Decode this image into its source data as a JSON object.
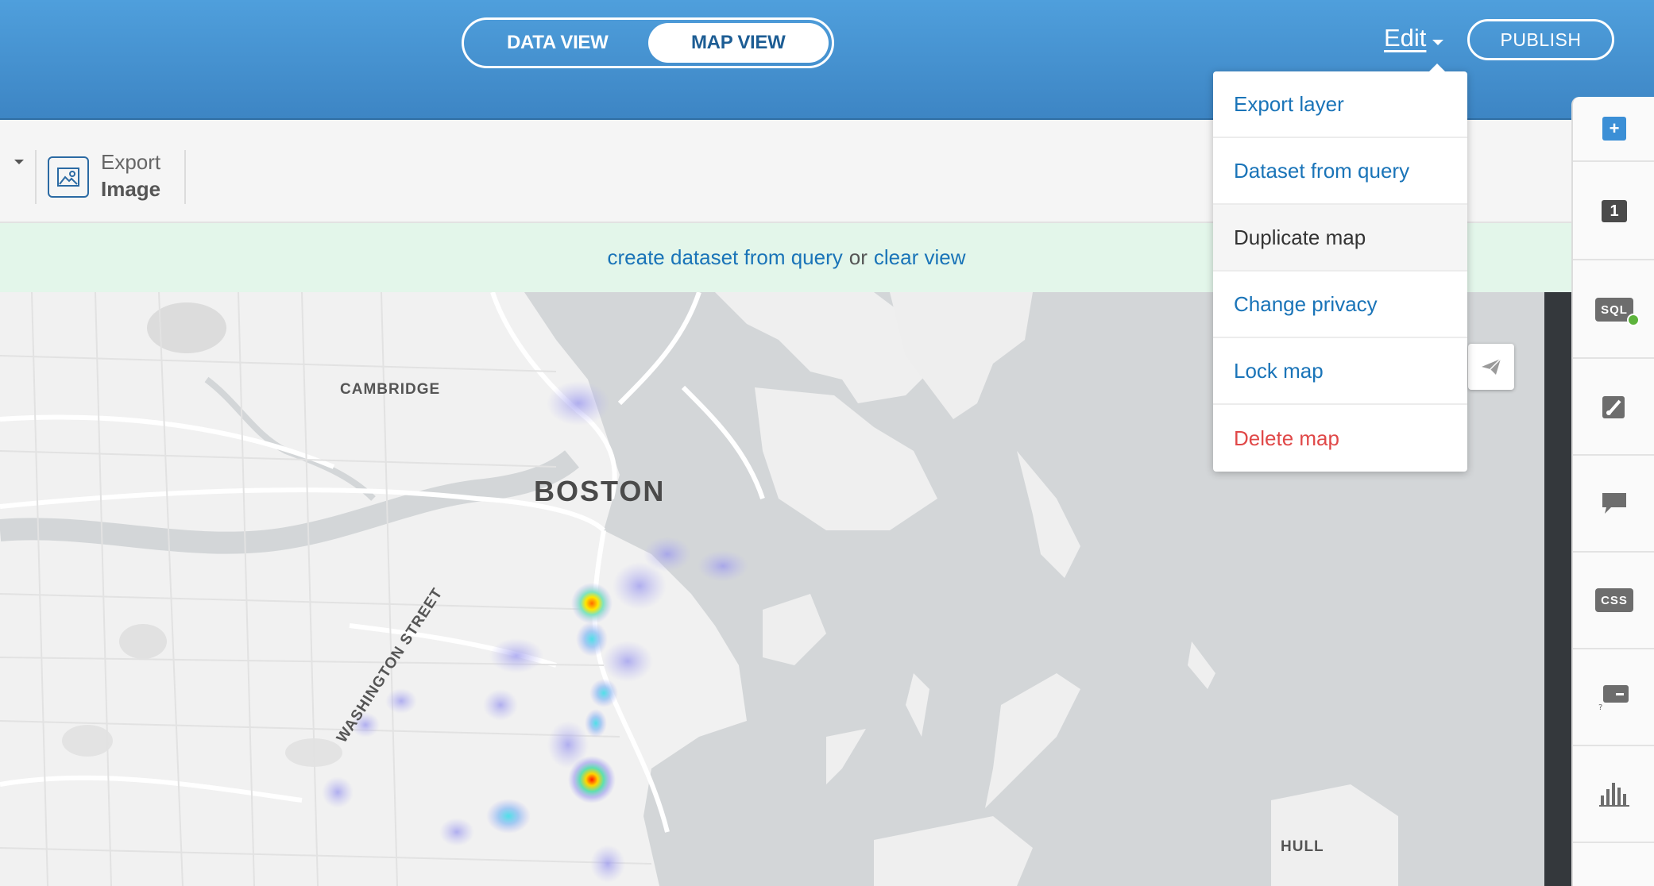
{
  "header": {
    "view_toggle": {
      "data_view": "DATA VIEW",
      "map_view": "MAP VIEW",
      "active": "map_view"
    },
    "edit_label": "Edit",
    "publish_label": "PUBLISH"
  },
  "toolbar": {
    "export_image": {
      "line1": "Export",
      "line2": "Image",
      "icon": "image-icon"
    }
  },
  "notice": {
    "create_link": "create dataset from query",
    "separator": "or",
    "clear_link": "clear view"
  },
  "edit_menu": {
    "items": [
      {
        "label": "Export layer",
        "style": "link"
      },
      {
        "label": "Dataset from query",
        "style": "link"
      },
      {
        "label": "Duplicate map",
        "style": "hover"
      },
      {
        "label": "Change privacy",
        "style": "link"
      },
      {
        "label": "Lock map",
        "style": "link"
      },
      {
        "label": "Delete map",
        "style": "danger"
      }
    ]
  },
  "map": {
    "labels": {
      "cambridge": "CAMBRIDGE",
      "boston": "BOSTON",
      "washington_street": "WASHINGTON STREET",
      "hull": "HULL"
    }
  },
  "side_panel": {
    "add_icon": "plus-icon",
    "layer_number": "1",
    "sql_label": "SQL",
    "css_label": "CSS",
    "icons": [
      "sql-icon",
      "brush-icon",
      "comment-icon",
      "css-icon",
      "legend-icon",
      "histogram-icon"
    ]
  },
  "colors": {
    "header_blue": "#4a97d6",
    "link_blue": "#1a74b8",
    "danger_red": "#e04848",
    "notice_green": "#e3f6ea",
    "water_gray": "#d3d6d8"
  }
}
